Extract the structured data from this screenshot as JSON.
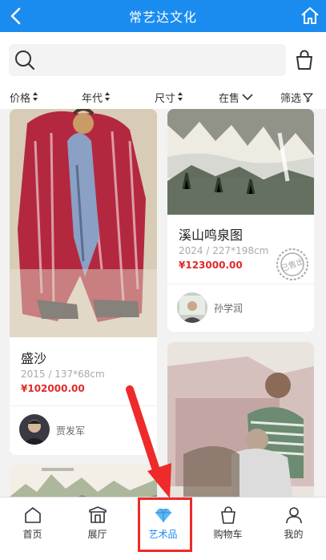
{
  "header": {
    "title": "常艺达文化",
    "back_icon": "chevron-left-icon",
    "home_icon": "home-icon"
  },
  "search": {
    "placeholder": "",
    "value": ""
  },
  "filters": [
    {
      "label": "价格",
      "icon": "sort-icon"
    },
    {
      "label": "年代",
      "icon": "sort-icon"
    },
    {
      "label": "尺寸",
      "icon": "sort-icon"
    },
    {
      "label": "在售",
      "icon": "chevron-down-icon"
    },
    {
      "label": "筛选",
      "icon": "filter-icon"
    }
  ],
  "artworks": [
    {
      "title": "盛沙",
      "meta": "2015 / 137*68cm",
      "price": "¥102000.00",
      "artist": "贾发军"
    },
    {
      "title": "溪山鸣泉图",
      "meta": "2024 / 227*198cm",
      "price": "¥123000.00",
      "artist": "孙学润",
      "stamp": "已售出"
    }
  ],
  "bottom_nav": [
    {
      "label": "首页",
      "icon": "home-icon"
    },
    {
      "label": "展厅",
      "icon": "gallery-icon"
    },
    {
      "label": "艺术品",
      "icon": "diamond-icon",
      "active": true
    },
    {
      "label": "购物车",
      "icon": "shopping-bag-icon"
    },
    {
      "label": "我的",
      "icon": "user-icon"
    }
  ],
  "colors": {
    "primary": "#1a8cf0",
    "price": "#e02a2a",
    "highlight": "#ee2a2a"
  }
}
